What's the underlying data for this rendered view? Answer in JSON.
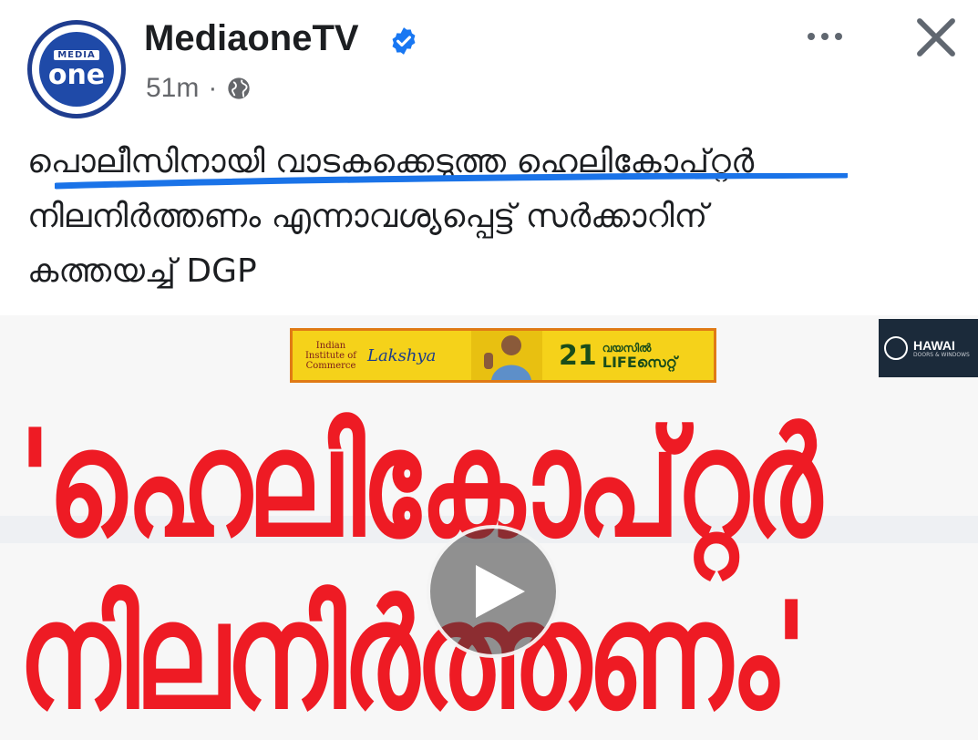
{
  "post": {
    "page_name": "MediaoneTV",
    "timestamp": "51m",
    "separator": "·",
    "privacy_icon": "globe-icon",
    "verified_icon": "verified-badge-icon",
    "more_icon": "more-options-icon",
    "close_icon": "close-icon"
  },
  "avatar": {
    "top_text": "MEDIA",
    "main_text": "one"
  },
  "caption": {
    "lines": [
      "പൊലീസിനായി വാടകക്കെടുത്ത ഹെലികോപ്റ്റർ",
      "നിലനിർത്തണം എന്നാവശ്യപ്പെട്ട് സർക്കാറിന്",
      "കത്തയച്ച്  DGP"
    ]
  },
  "media": {
    "ad": {
      "institute": "Indian Institute of Commerce",
      "brand": "Lakshya",
      "age": "21",
      "tagline_top": "വയസിൽ",
      "tagline_bottom": "LIFEസെറ്റ്"
    },
    "sponsor": {
      "name": "HAWAI",
      "sub": "DOORS & WINDOWS"
    },
    "headline": {
      "line1": "'ഹെലികോപ്റ്റർ",
      "line2": "നിലനിർത്തണം'"
    },
    "play_icon": "play-icon"
  },
  "colors": {
    "headline": "#ee1b24",
    "highlight_underline": "#1a73e8",
    "verified": "#1877f2",
    "ad_background": "#f5d21a"
  }
}
